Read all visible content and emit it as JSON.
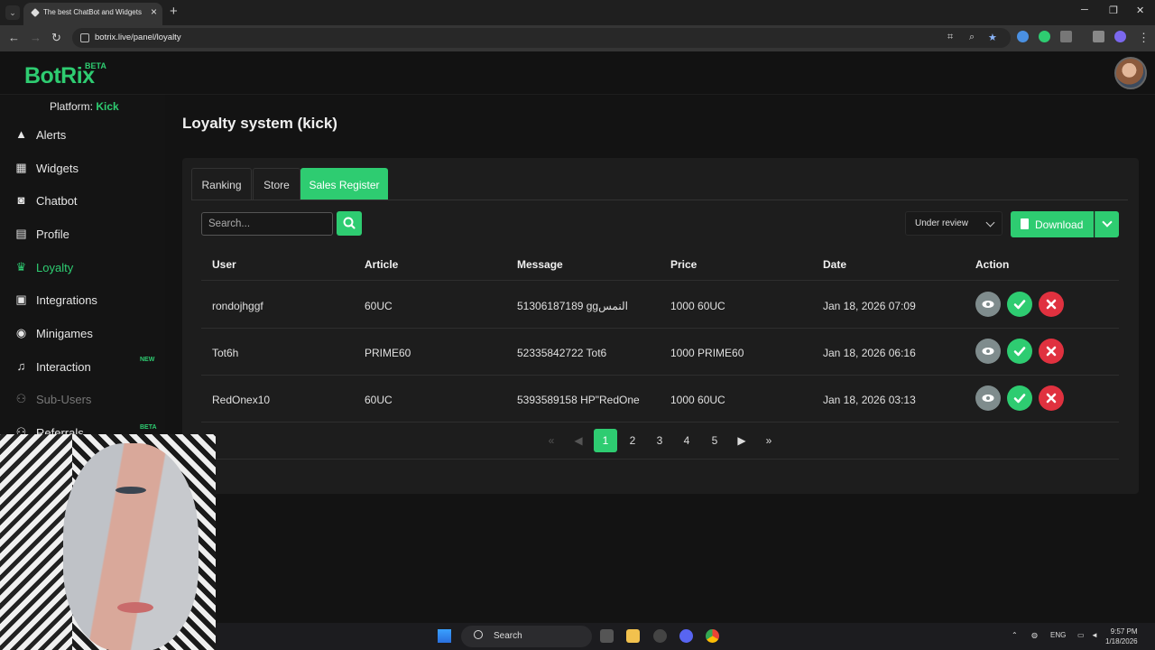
{
  "browser": {
    "tab_title": "The best ChatBot and Widgets",
    "url": "botrix.live/panel/loyalty"
  },
  "header": {
    "logo": "BotRix",
    "logo_badge": "BETA"
  },
  "sidebar": {
    "platform_label": "Platform:",
    "platform_value": "Kick",
    "items": [
      {
        "label": "Alerts",
        "icon": "warning-icon"
      },
      {
        "label": "Widgets",
        "icon": "grid-icon"
      },
      {
        "label": "Chatbot",
        "icon": "robot-icon"
      },
      {
        "label": "Profile",
        "icon": "id-card-icon"
      },
      {
        "label": "Loyalty",
        "icon": "trophy-icon"
      },
      {
        "label": "Integrations",
        "icon": "plug-icon"
      },
      {
        "label": "Minigames",
        "icon": "gamepad-icon"
      },
      {
        "label": "Interaction",
        "icon": "music-icon",
        "badge": "NEW"
      },
      {
        "label": "Sub-Users",
        "icon": "users-icon"
      },
      {
        "label": "Referrals",
        "icon": "users-icon",
        "badge": "BETA"
      }
    ]
  },
  "main": {
    "title": "Loyalty system (kick)",
    "tabs": [
      "Ranking",
      "Store",
      "Sales Register"
    ],
    "active_tab": "Sales Register",
    "search_placeholder": "Search...",
    "status_filter": "Under review",
    "download_label": "Download",
    "columns": [
      "User",
      "Article",
      "Message",
      "Price",
      "Date",
      "Action"
    ],
    "rows": [
      {
        "user": "rondojhggf",
        "article": "60UC",
        "message": "51306187189 ggالنمس",
        "price": "1000 60UC",
        "date": "Jan 18, 2026 07:09"
      },
      {
        "user": "Tot6h",
        "article": "PRIME60",
        "message": "52335842722 Tot6",
        "price": "1000 PRIME60",
        "date": "Jan 18, 2026 06:16"
      },
      {
        "user": "RedOnex10",
        "article": "60UC",
        "message": "5393589158 HP\"RedOne",
        "price": "1000 60UC",
        "date": "Jan 18, 2026 03:13"
      }
    ],
    "pagination": {
      "pages": [
        "1",
        "2",
        "3",
        "4",
        "5"
      ],
      "current": "1"
    }
  },
  "taskbar": {
    "search_label": "Search",
    "lang": "ENG",
    "time": "9:57 PM",
    "date": "1/18/2026"
  },
  "colors": {
    "accent": "#2ecc71",
    "danger": "#e0313f",
    "neutral": "#7f8c8d"
  }
}
